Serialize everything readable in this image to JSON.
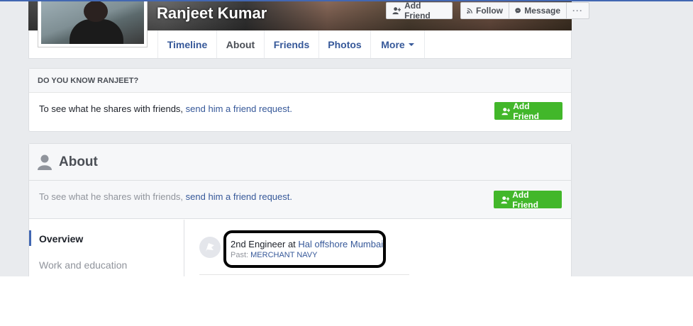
{
  "profile": {
    "name": "Ranjeet Kumar"
  },
  "cover_actions": {
    "add_friend": "Add Friend",
    "follow": "Follow",
    "message": "Message",
    "more": "···"
  },
  "nav": {
    "tabs": [
      {
        "label": "Timeline"
      },
      {
        "label": "About"
      },
      {
        "label": "Friends"
      },
      {
        "label": "Photos"
      },
      {
        "label": "More"
      }
    ],
    "active": "About"
  },
  "know_card": {
    "header": "DO YOU KNOW RANJEET?",
    "text": "To see what he shares with friends, ",
    "link": "send him a friend request.",
    "button": "Add Friend"
  },
  "about": {
    "title": "About",
    "notice_text": "To see what he shares with friends, ",
    "notice_link": "send him a friend request.",
    "button": "Add Friend",
    "sidebar": [
      {
        "label": "Overview"
      },
      {
        "label": "Work and education"
      }
    ],
    "work": {
      "role": "2nd Engineer at ",
      "company": "Hal offshore Mumbai",
      "past_label": "Past: ",
      "past_value": "MERCHANT NAVY"
    }
  },
  "colors": {
    "brand_blue": "#4267b2",
    "link_blue": "#365899",
    "green": "#42b72a",
    "background": "#e9ebee"
  }
}
